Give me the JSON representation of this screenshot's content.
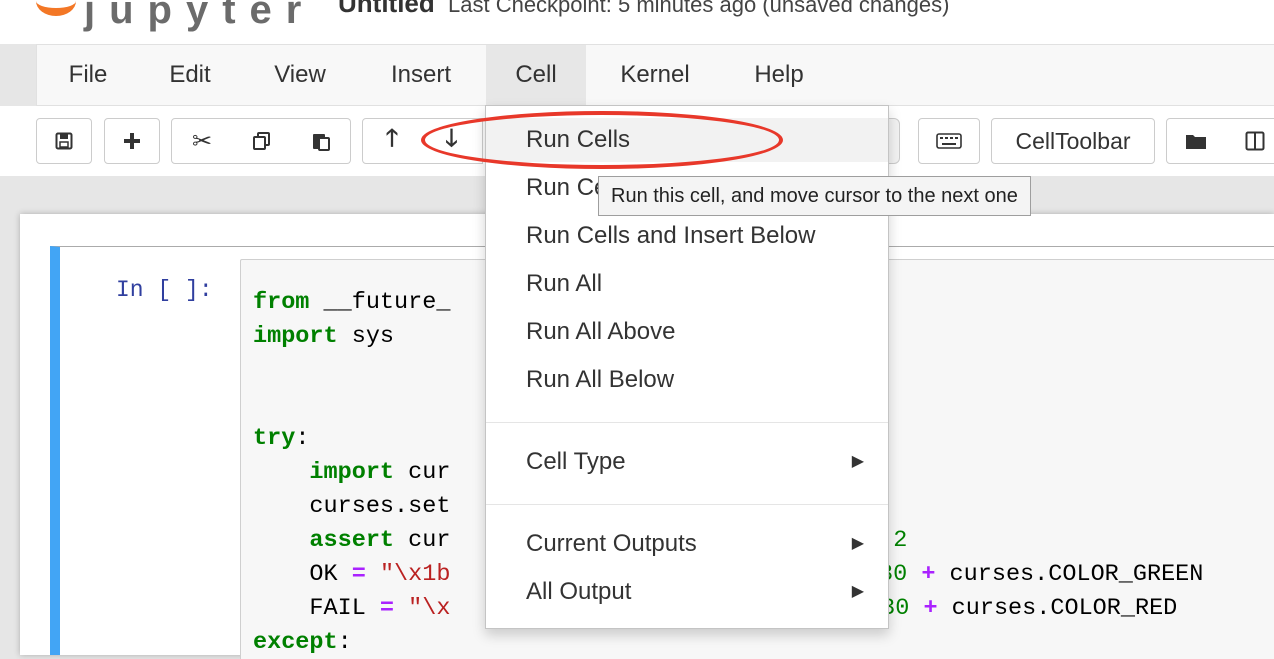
{
  "header": {
    "logo_text": "jupyter",
    "notebook_name": "Untitled",
    "checkpoint_text": "Last Checkpoint: 5 minutes ago (unsaved changes)"
  },
  "menubar": {
    "items": [
      "File",
      "Edit",
      "View",
      "Insert",
      "Cell",
      "Kernel",
      "Help"
    ],
    "active": "Cell"
  },
  "toolbar": {
    "celltoolbar_label": "CellToolbar"
  },
  "cell": {
    "prompt": "In [ ]:",
    "code_lines": [
      "from __future_",
      "import sys",
      "",
      "",
      "try:",
      "    import cur",
      "    curses.set",
      "    assert cur",
      "    OK = \"\\x1b",
      "    FAIL = \"\\x",
      "except:"
    ],
    "right_fragments": {
      "line8": "+ 2",
      "line9": "30 + curses.COLOR_GREEN",
      "line10": "(30 + curses.COLOR_RED"
    }
  },
  "dropdown": {
    "items": [
      {
        "label": "Run Cells"
      },
      {
        "label": "Run Cells and Select Below"
      },
      {
        "label": "Run Cells and Insert Below"
      },
      {
        "label": "Run All"
      },
      {
        "label": "Run All Above"
      },
      {
        "label": "Run All Below"
      },
      {
        "label": "Cell Type"
      },
      {
        "label": "Current Outputs"
      },
      {
        "label": "All Output"
      }
    ]
  },
  "tooltip": {
    "text": "Run this cell, and move cursor to the next one"
  },
  "colors": {
    "annotation": "#e8382a",
    "cell_border": "#42a5f5",
    "keyword": "#008000",
    "string": "#ba2121",
    "operator": "#aa22ff",
    "prompt": "#303f9f"
  }
}
